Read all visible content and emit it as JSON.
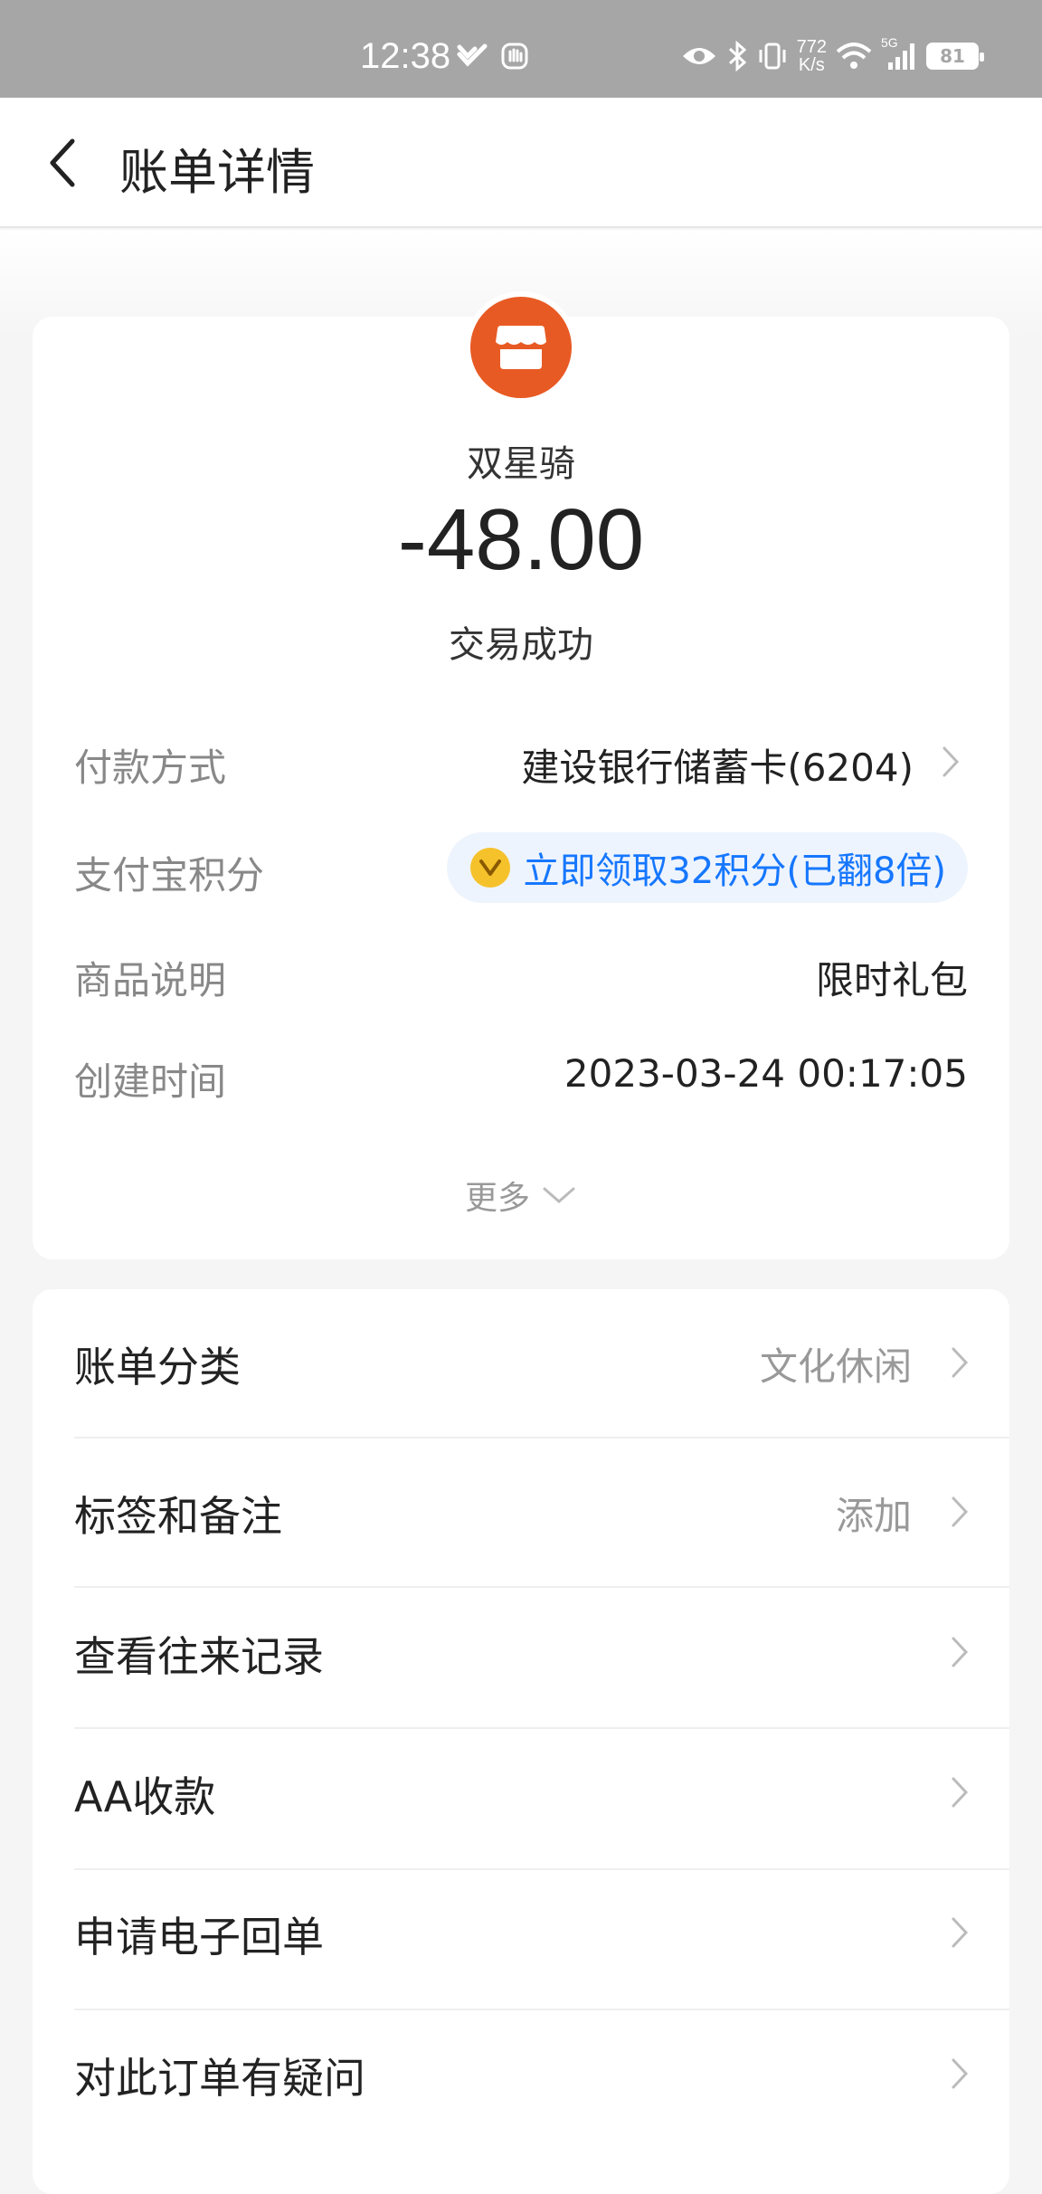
{
  "status_bar": {
    "time": "12:38",
    "net_speed_value": "772",
    "net_speed_unit": "K/s",
    "network_type": "5G",
    "battery": "81"
  },
  "nav": {
    "title": "账单详情"
  },
  "merchant": {
    "name": "双星骑",
    "amount": "-48.00",
    "status": "交易成功"
  },
  "details": [
    {
      "label": "付款方式",
      "value": "建设银行储蓄卡(6204)"
    },
    {
      "label": "支付宝积分",
      "value": "立即领取32积分(已翻8倍)"
    },
    {
      "label": "商品说明",
      "value": "限时礼包"
    },
    {
      "label": "创建时间",
      "value": "2023-03-24 00:17:05"
    }
  ],
  "more_label": "更多",
  "menu": [
    {
      "label": "账单分类",
      "value": "文化休闲"
    },
    {
      "label": "标签和备注",
      "value": "添加"
    },
    {
      "label": "查看往来记录",
      "value": ""
    },
    {
      "label": "AA收款",
      "value": ""
    },
    {
      "label": "申请电子回单",
      "value": ""
    },
    {
      "label": "对此订单有疑问",
      "value": ""
    }
  ],
  "colors": {
    "accent_blue": "#1677ff",
    "merchant_orange": "#e85a24",
    "coin_yellow": "#f6c22b"
  }
}
